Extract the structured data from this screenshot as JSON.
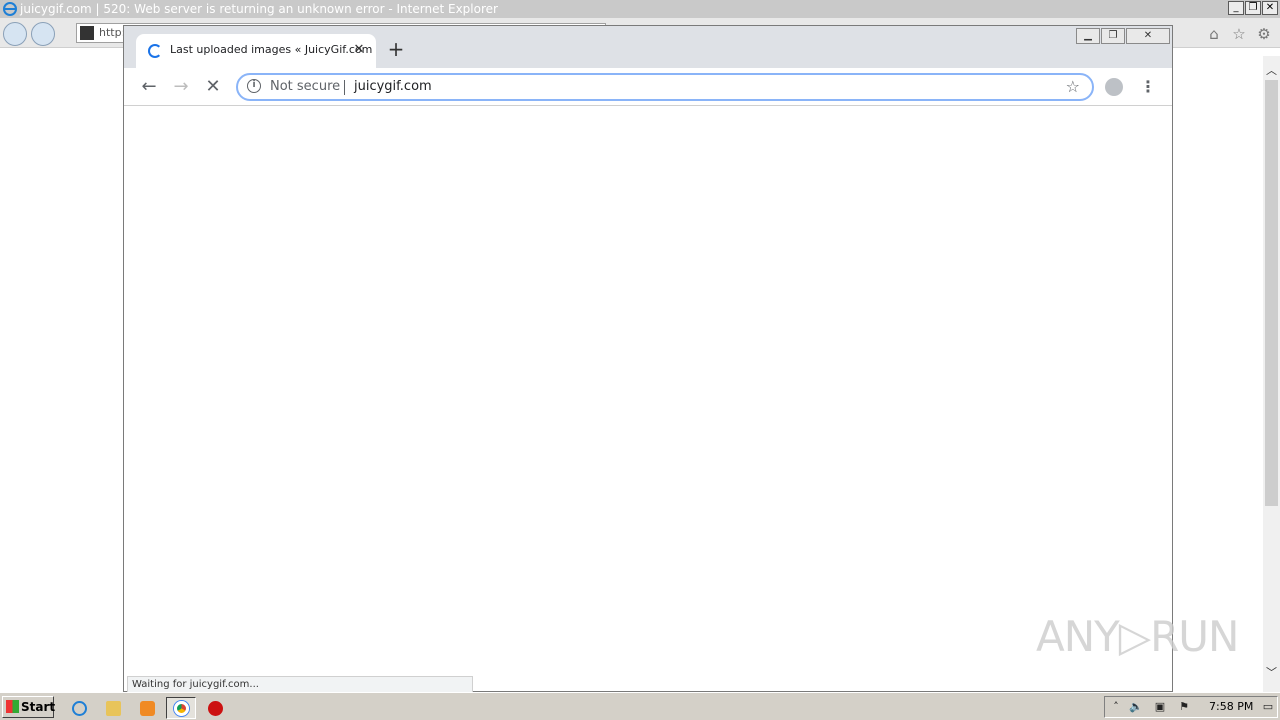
{
  "ie": {
    "title": "juicygif.com | 520: Web server is returning an unknown error - Internet Explorer",
    "address_partial": "http:",
    "window_buttons": {
      "minimize": "_",
      "restore": "❐",
      "close": "✕"
    }
  },
  "chrome": {
    "tab": {
      "title": "Last uploaded images « JuicyGif.com",
      "close": "✕"
    },
    "new_tab": "+",
    "omnibox": {
      "security": "Not secure",
      "url": "juicygif.com"
    },
    "status": "Waiting for juicygif.com..."
  },
  "watermark": "ANY▷RUN",
  "taskbar": {
    "start_label": "Start",
    "clock": "7:58 PM"
  },
  "colors": {
    "chrome_accent": "#1a73e8",
    "tabstrip": "#dee1e6",
    "taskbar": "#d4d0c8"
  }
}
